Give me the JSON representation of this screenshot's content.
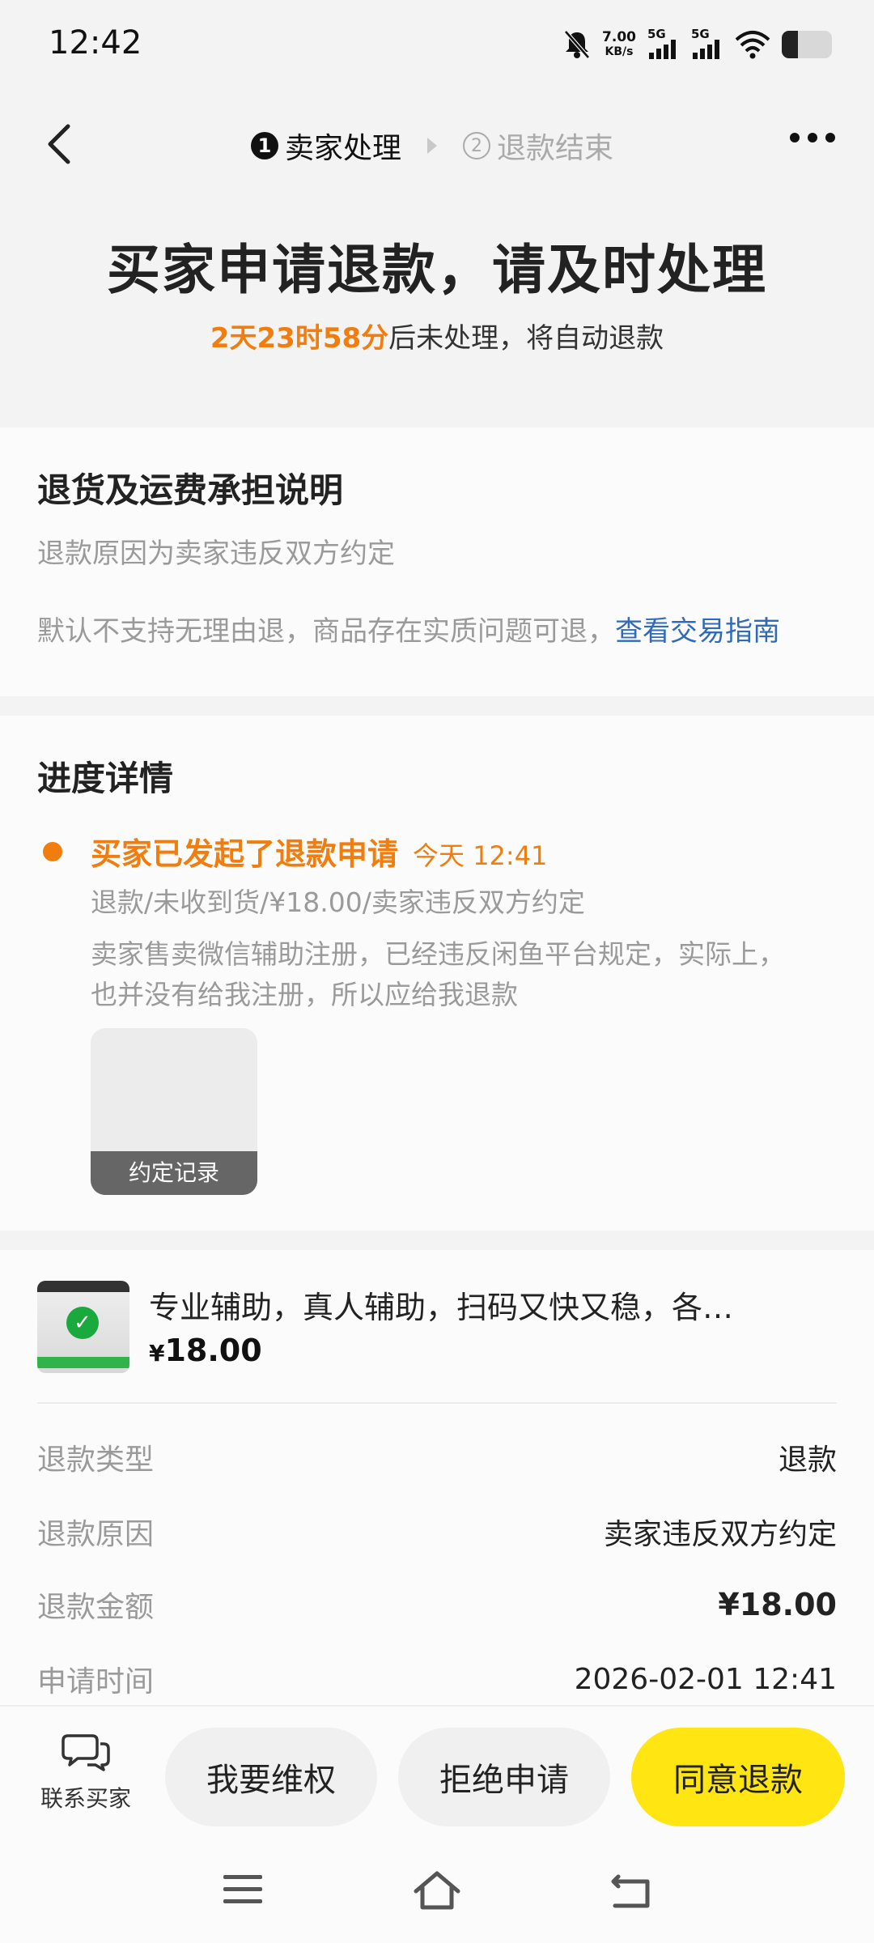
{
  "status_bar": {
    "time": "12:42",
    "net_speed_value": "7.00",
    "net_speed_unit": "KB/s",
    "sim1": "5G",
    "sim2": "5G",
    "battery_level": 0.32,
    "icons": [
      "mute-bell-icon",
      "signal-icon",
      "wifi-icon",
      "battery-icon"
    ]
  },
  "header": {
    "step1_num": "1",
    "step1_label": "卖家处理",
    "step2_num": "2",
    "step2_label": "退款结束"
  },
  "title": {
    "main": "买家申请退款，请及时处理",
    "countdown": "2天23时58分",
    "countdown_suffix": "后未处理，将自动退款"
  },
  "explain": {
    "title": "退货及运费承担说明",
    "line1": "退款原因为卖家违反双方约定",
    "line2": "默认不支持无理由退，商品存在实质问题可退，",
    "link": "查看交易指南"
  },
  "progress": {
    "title": "进度详情",
    "event": "买家已发起了退款申请",
    "event_time": "今天 12:41",
    "summary": "退款/未收到货/¥18.00/卖家违反双方约定",
    "description": "卖家售卖微信辅助注册，已经违反闲鱼平台规定，实际上，也并没有给我注册，所以应给我退款",
    "attachment_label": "约定记录"
  },
  "product": {
    "title": "专业辅助，真人辅助，扫码又快又稳，各…",
    "price_symbol": "¥",
    "price": "18.00"
  },
  "details": {
    "type_label": "退款类型",
    "type_value": "退款",
    "reason_label": "退款原因",
    "reason_value": "卖家违反双方约定",
    "amount_label": "退款金额",
    "amount_value": "¥18.00",
    "time_label": "申请时间",
    "time_value": "2026-02-01 12:41"
  },
  "actions": {
    "contact_label": "联系买家",
    "rights_label": "我要维权",
    "reject_label": "拒绝申请",
    "agree_label": "同意退款"
  },
  "colors": {
    "accent_orange": "#f07d0e",
    "primary_yellow": "#ffe512",
    "link_blue": "#2f6bb8"
  }
}
